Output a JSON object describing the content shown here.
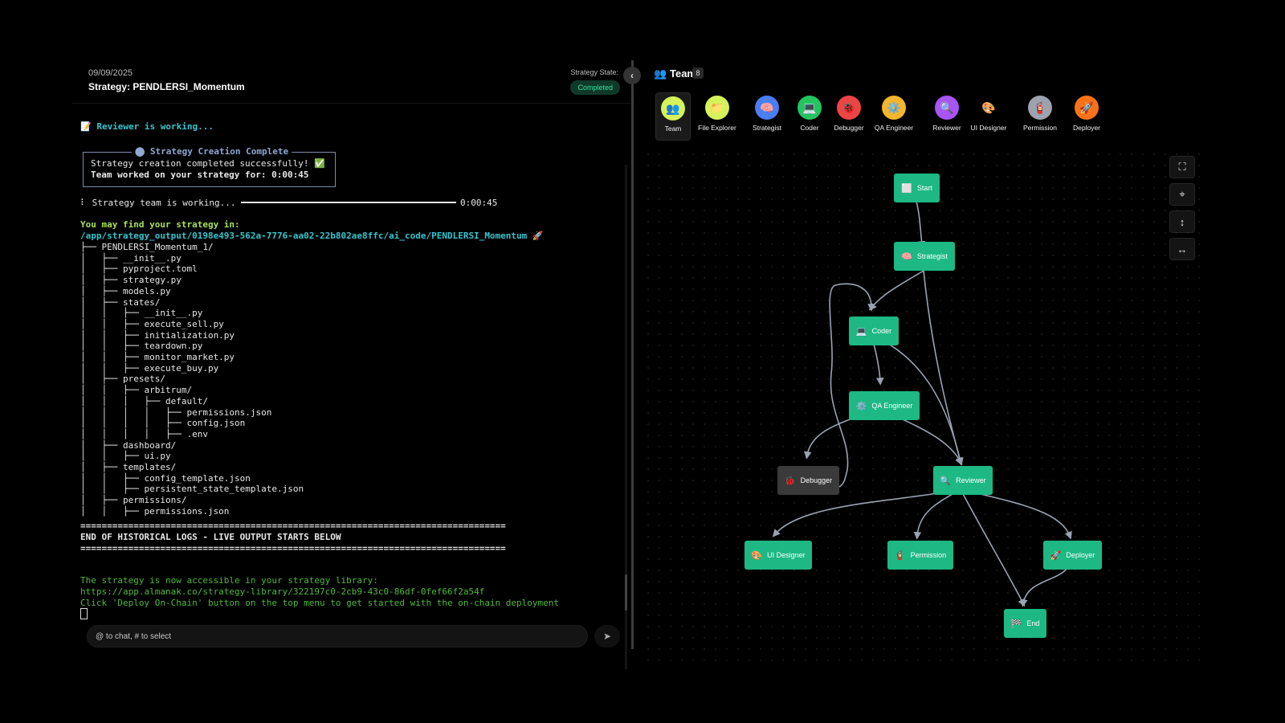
{
  "header": {
    "date": "09/09/2025",
    "title": "Strategy: PENDLERSI_Momentum",
    "state_label": "Strategy State:",
    "state_value": "Completed"
  },
  "terminal": {
    "working": "📝 Reviewer is working...",
    "box_title": "⬤ Strategy Creation Complete",
    "box_line1": "Strategy creation completed successfully! ✅",
    "box_line2": "Team worked on your strategy for: 0:00:45",
    "progress_label": "⠇ Strategy team is working...",
    "progress_time": "0:00:45",
    "find_label": "You may find your strategy in:",
    "path": "/app/strategy_output/0198e493-562a-7776-aa02-22b802ae8ffc/ai_code/PENDLERSI_Momentum 🚀",
    "tree": [
      "├── PENDLERSI_Momentum_1/",
      "│   ├── __init__.py",
      "│   ├── pyproject.toml",
      "│   ├── strategy.py",
      "│   ├── models.py",
      "│   ├── states/",
      "│   │   ├── __init__.py",
      "│   │   ├── execute_sell.py",
      "│   │   ├── initialization.py",
      "│   │   ├── teardown.py",
      "│   │   ├── monitor_market.py",
      "│   │   ├── execute_buy.py",
      "│   ├── presets/",
      "│   │   ├── arbitrum/",
      "│   │   │   ├── default/",
      "│   │   │   │   ├── permissions.json",
      "│   │   │   │   ├── config.json",
      "│   │   │   │   ├── .env",
      "│   ├── dashboard/",
      "│   │   ├── ui.py",
      "│   ├── templates/",
      "│   │   ├── config_template.json",
      "│   │   ├── persistent_state_template.json",
      "│   ├── permissions/",
      "│   │   ├── permissions.json"
    ],
    "separator": "================================================================================",
    "end_marker": "END OF HISTORICAL LOGS - LIVE OUTPUT STARTS BELOW",
    "library_msg": "The strategy is now accessible in your strategy library:",
    "library_url": "https://app.almanak.co/strategy-library/322197c0-2cb9-43c0-86df-0fef66f2a54f",
    "deploy_msg": "Click 'Deploy On-Chain' button on the top menu to get started with the on-chain deployment"
  },
  "chat": {
    "placeholder": "@ to chat, # to select"
  },
  "team": {
    "title": "Team",
    "count": "8",
    "agents": [
      {
        "label": "Team",
        "icon": "👥",
        "color": "#d6f25a"
      },
      {
        "label": "File Explorer",
        "icon": "📁",
        "color": "#d6f25a"
      },
      {
        "label": "Strategist",
        "icon": "🧠",
        "color": "#4a7ef5"
      },
      {
        "label": "Coder",
        "icon": "💻",
        "color": "#22c55e"
      },
      {
        "label": "Debugger",
        "icon": "🐞",
        "color": "#ef4444"
      },
      {
        "label": "QA Engineer",
        "icon": "⚙️",
        "color": "#f3b62b"
      },
      {
        "label": "Reviewer",
        "icon": "🔍",
        "color": "#a855f7"
      },
      {
        "label": "UI Designer",
        "icon": "🎨",
        "color": "#000000"
      },
      {
        "label": "Permission",
        "icon": "🧯",
        "color": "#9ca3af"
      },
      {
        "label": "Deployer",
        "icon": "🚀",
        "color": "#f97316"
      }
    ]
  },
  "nodes": {
    "start": {
      "label": "Start",
      "icon": "⬜"
    },
    "strategist": {
      "label": "Strategist",
      "icon": "🧠"
    },
    "coder": {
      "label": "Coder",
      "icon": "💻"
    },
    "qa": {
      "label": "QA Engineer",
      "icon": "⚙️"
    },
    "debugger": {
      "label": "Debugger",
      "icon": "🐞"
    },
    "reviewer": {
      "label": "Reviewer",
      "icon": "🔍"
    },
    "ui": {
      "label": "UI Designer",
      "icon": "🎨"
    },
    "permission": {
      "label": "Permission",
      "icon": "🧯"
    },
    "deployer": {
      "label": "Deployer",
      "icon": "🚀"
    },
    "end": {
      "label": "End",
      "icon": "🏁"
    }
  },
  "colors": {
    "node_green": "#1db884",
    "node_dark": "#3a3a3a",
    "edge": "#9aa3b2",
    "completed": "#2ee59d"
  }
}
